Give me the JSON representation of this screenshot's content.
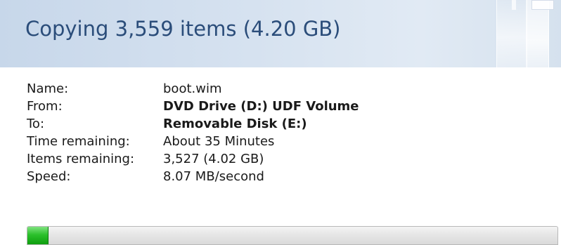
{
  "header": {
    "title": "Copying 3,559 items (4.20 GB)"
  },
  "details": {
    "name_label": "Name:",
    "name_value": "boot.wim",
    "from_label": "From:",
    "from_value": "DVD Drive (D:) UDF Volume",
    "to_label": "To:",
    "to_value": "Removable Disk (E:)",
    "time_label": "Time remaining:",
    "time_value": "About 35 Minutes",
    "items_label": "Items remaining:",
    "items_value": "3,527 (4.02 GB)",
    "speed_label": "Speed:",
    "speed_value": "8.07 MB/second"
  },
  "progress": {
    "fraction": 0.04,
    "color": "#2cc12c"
  },
  "colors": {
    "title": "#2b4d7a",
    "header_background": "#d6e2f0"
  }
}
